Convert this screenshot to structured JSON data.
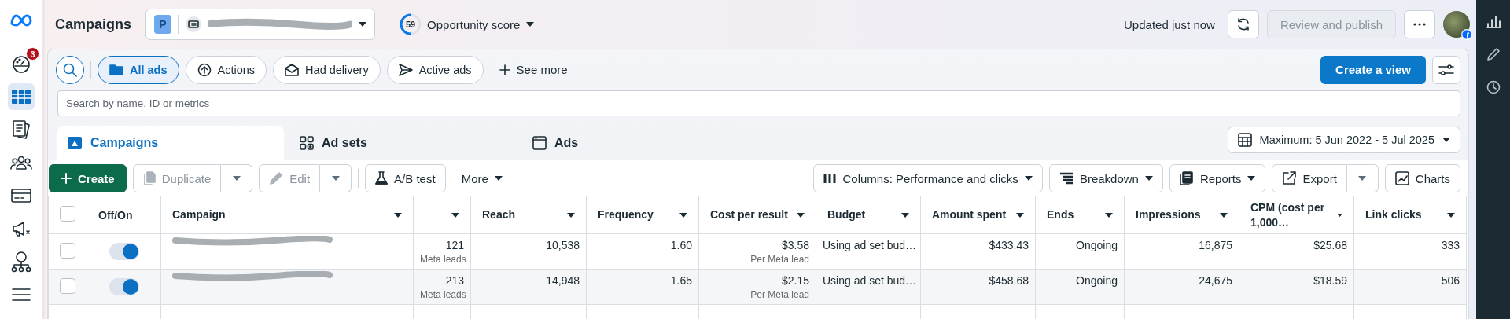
{
  "nav": {
    "items": [
      {
        "selected": false,
        "badge": "3"
      },
      {
        "selected": true
      },
      {
        "selected": false
      },
      {
        "selected": false
      },
      {
        "selected": false
      },
      {
        "selected": false
      },
      {
        "selected": false
      },
      {
        "selected": false
      }
    ]
  },
  "header": {
    "title": "Campaigns",
    "account": {
      "initial": "P"
    },
    "opportunity_score": {
      "value": "59",
      "label": "Opportunity score",
      "level": 0.5
    },
    "updated": "Updated just now",
    "review_button": {
      "label": "Review and publish",
      "disabled": true
    }
  },
  "filters": {
    "chips": [
      {
        "label": "All ads",
        "selected": true
      },
      {
        "label": "Actions",
        "selected": false
      },
      {
        "label": "Had delivery",
        "selected": false
      },
      {
        "label": "Active ads",
        "selected": false
      }
    ],
    "see_more": "See more",
    "create_view": "Create a view"
  },
  "search": {
    "placeholder": "Search by name, ID or metrics"
  },
  "tabs": [
    {
      "label": "Campaigns",
      "selected": true
    },
    {
      "label": "Ad sets",
      "selected": false
    },
    {
      "label": "Ads",
      "selected": false
    }
  ],
  "date_range": "Maximum: 5 Jun 2022 - 5 Jul 2025",
  "toolbar": {
    "create": "Create",
    "duplicate": {
      "label": "Duplicate",
      "disabled": true
    },
    "edit": {
      "label": "Edit",
      "disabled": true
    },
    "ab_test": "A/B test",
    "more": "More",
    "columns": "Columns: Performance and clicks",
    "breakdown": "Breakdown",
    "reports": "Reports",
    "export": "Export",
    "charts": "Charts"
  },
  "table": {
    "select_all_checked": false,
    "columns": [
      {
        "kind": "checkbox"
      },
      {
        "kind": "toggle",
        "label": "Off/On"
      },
      {
        "kind": "name",
        "label": "Campaign"
      },
      {
        "kind": "number"
      },
      {
        "kind": "number",
        "label": "Reach"
      },
      {
        "kind": "number",
        "label": "Frequency"
      },
      {
        "kind": "number",
        "label": "Cost per result"
      },
      {
        "kind": "text",
        "label": "Budget"
      },
      {
        "kind": "number",
        "label": "Amount spent"
      },
      {
        "kind": "number",
        "label": "Ends"
      },
      {
        "kind": "number",
        "label": "Impressions"
      },
      {
        "kind": "number",
        "label": "CPM (cost per 1,000…"
      },
      {
        "kind": "number",
        "label": "Link clicks"
      }
    ],
    "rows": [
      {
        "checked": false,
        "on": true,
        "cells": [
          "",
          "",
          "",
          {
            "text": "121",
            "note": "Meta leads"
          },
          {
            "text": "10,538"
          },
          {
            "text": "1.60"
          },
          {
            "text": "$3.58",
            "note": "Per Meta lead"
          },
          {
            "text": "Using ad set bud…"
          },
          {
            "text": "$433.43"
          },
          {
            "text": "Ongoing"
          },
          {
            "text": "16,875"
          },
          {
            "text": "$25.68"
          },
          {
            "text": "333"
          }
        ]
      },
      {
        "checked": false,
        "on": true,
        "cells": [
          "",
          "",
          "",
          {
            "text": "213",
            "note": "Meta leads"
          },
          {
            "text": "14,948"
          },
          {
            "text": "1.65"
          },
          {
            "text": "$2.15",
            "note": "Per Meta lead"
          },
          {
            "text": "Using ad set bud…"
          },
          {
            "text": "$458.68"
          },
          {
            "text": "Ongoing"
          },
          {
            "text": "24,675"
          },
          {
            "text": "$18.59"
          },
          {
            "text": "506"
          }
        ]
      }
    ]
  }
}
